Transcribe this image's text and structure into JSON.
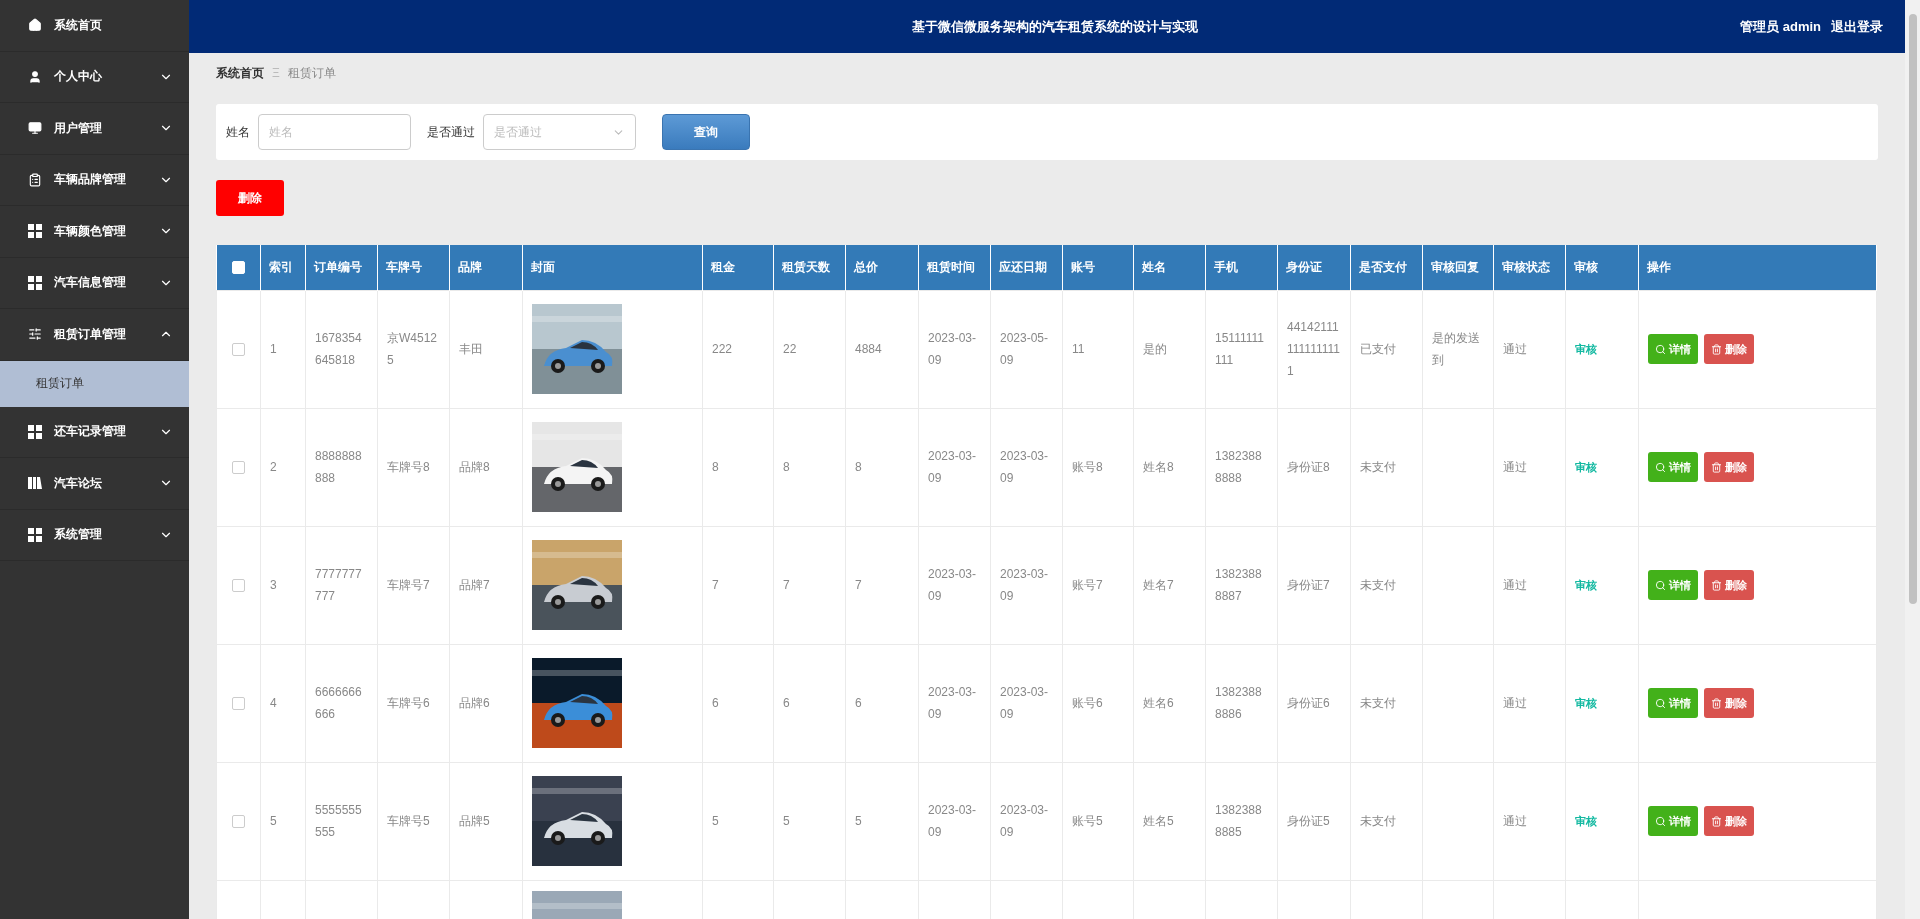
{
  "sidebar": {
    "items": [
      {
        "label": "系统首页",
        "kind": "link"
      },
      {
        "label": "个人中心",
        "kind": "menu",
        "expanded": false
      },
      {
        "label": "用户管理",
        "kind": "menu",
        "expanded": false
      },
      {
        "label": "车辆品牌管理",
        "kind": "menu",
        "expanded": false
      },
      {
        "label": "车辆颜色管理",
        "kind": "menu",
        "expanded": false
      },
      {
        "label": "汽车信息管理",
        "kind": "menu",
        "expanded": false
      },
      {
        "label": "租赁订单管理",
        "kind": "menu",
        "expanded": true,
        "children": [
          {
            "label": "租赁订单",
            "selected": true
          }
        ]
      },
      {
        "label": "还车记录管理",
        "kind": "menu",
        "expanded": false
      },
      {
        "label": "汽车论坛",
        "kind": "menu",
        "expanded": false
      },
      {
        "label": "系统管理",
        "kind": "menu",
        "expanded": false
      }
    ]
  },
  "header": {
    "title": "基于微信微服务架构的汽车租赁系统的设计与实现",
    "user": "管理员 admin",
    "logout": "退出登录"
  },
  "breadcrumb": {
    "home": "系统首页",
    "separator": "Ξ",
    "current": "租赁订单"
  },
  "search": {
    "fields": [
      {
        "kind": "input",
        "label": "姓名",
        "placeholder": "姓名"
      },
      {
        "kind": "select",
        "label": "是否通过",
        "placeholder": "是否通过"
      }
    ],
    "button": "查询"
  },
  "delete_button": "删除",
  "table": {
    "select_all": {
      "checked": false
    },
    "columns": [
      "索引",
      "订单编号",
      "车牌号",
      "品牌",
      "封面",
      "租金",
      "租赁天数",
      "总价",
      "租赁时间",
      "应还日期",
      "账号",
      "姓名",
      "手机",
      "身份证",
      "是否支付",
      "审核回复",
      "审核状态",
      "审核",
      "操作"
    ],
    "rows": [
      {
        "kind": "full",
        "checked": false,
        "cells": [
          "1",
          "1678354645818",
          "京W45125",
          "丰田",
          "222",
          "22",
          "4884",
          "2023-03-09",
          "2023-05-09",
          "11",
          "是的",
          "15111111111",
          "441421111111111111",
          "已支付",
          "是的发送到",
          "通过"
        ],
        "review": "审核",
        "detail": "详情",
        "delete": "删除"
      },
      {
        "kind": "full",
        "checked": false,
        "cells": [
          "2",
          "8888888888",
          "车牌号8",
          "品牌8",
          "8",
          "8",
          "8",
          "2023-03-09",
          "2023-03-09",
          "账号8",
          "姓名8",
          "13823888888",
          "身份证8",
          "未支付",
          "",
          "通过"
        ],
        "review": "审核",
        "detail": "详情",
        "delete": "删除"
      },
      {
        "kind": "full",
        "checked": false,
        "cells": [
          "3",
          "7777777777",
          "车牌号7",
          "品牌7",
          "7",
          "7",
          "7",
          "2023-03-09",
          "2023-03-09",
          "账号7",
          "姓名7",
          "13823888887",
          "身份证7",
          "未支付",
          "",
          "通过"
        ],
        "review": "审核",
        "detail": "详情",
        "delete": "删除"
      },
      {
        "kind": "full",
        "checked": false,
        "cells": [
          "4",
          "6666666666",
          "车牌号6",
          "品牌6",
          "6",
          "6",
          "6",
          "2023-03-09",
          "2023-03-09",
          "账号6",
          "姓名6",
          "13823888886",
          "身份证6",
          "未支付",
          "",
          "通过"
        ],
        "review": "审核",
        "detail": "详情",
        "delete": "删除"
      },
      {
        "kind": "full",
        "checked": false,
        "cells": [
          "5",
          "5555555555",
          "车牌号5",
          "品牌5",
          "5",
          "5",
          "5",
          "2023-03-09",
          "2023-03-09",
          "账号5",
          "姓名5",
          "13823888885",
          "身份证5",
          "未支付",
          "",
          "通过"
        ],
        "review": "审核",
        "detail": "详情",
        "delete": "删除"
      },
      {
        "kind": "partial"
      }
    ]
  }
}
